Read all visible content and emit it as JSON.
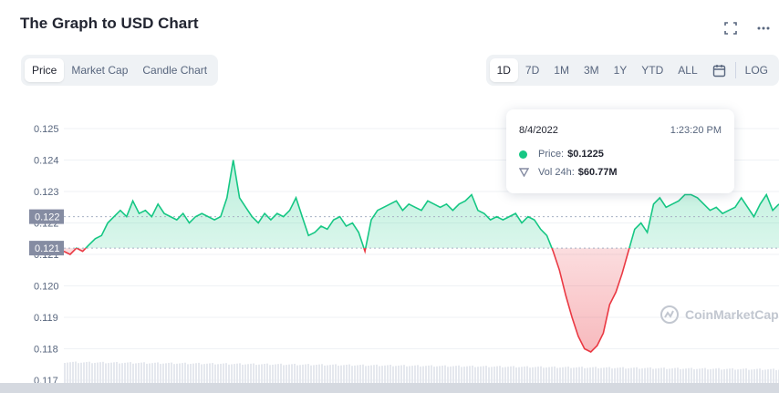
{
  "header": {
    "title": "The Graph to USD Chart"
  },
  "view_tabs": [
    {
      "label": "Price",
      "active": true
    },
    {
      "label": "Market Cap",
      "active": false
    },
    {
      "label": "Candle Chart",
      "active": false
    }
  ],
  "range_tabs": [
    {
      "label": "1D",
      "active": true
    },
    {
      "label": "7D",
      "active": false
    },
    {
      "label": "1M",
      "active": false
    },
    {
      "label": "3M",
      "active": false
    },
    {
      "label": "1Y",
      "active": false
    },
    {
      "label": "YTD",
      "active": false
    },
    {
      "label": "ALL",
      "active": false
    }
  ],
  "log_label": "LOG",
  "icons": [
    "fullscreen-icon",
    "more-icon",
    "calendar-icon",
    "coinmarketcap-logo-icon",
    "volume-icon"
  ],
  "tooltip": {
    "date": "8/4/2022",
    "time": "1:23:20 PM",
    "price_label": "Price:",
    "price_value": "$0.1225",
    "vol_label": "Vol 24h:",
    "vol_value": "$60.77M"
  },
  "watermark": "CoinMarketCap",
  "colors": {
    "up": "#16c784",
    "down": "#ea3943",
    "badge": "#858ca2",
    "text": "#222531",
    "muted": "#58667e"
  },
  "chart_data": {
    "type": "line",
    "y_ticks": [
      "0.125",
      "0.124",
      "0.123",
      "0.122",
      "0.121",
      "0.120",
      "0.119",
      "0.118",
      "0.117"
    ],
    "ylim": [
      0.117,
      0.1255
    ],
    "baseline": 0.1212,
    "reference_line": 0.1222,
    "badges": [
      "0.122",
      "0.121"
    ],
    "grid": true,
    "series": [
      {
        "values": [
          0.1211,
          0.121,
          0.1212,
          0.1211,
          0.1213,
          0.1215,
          0.1216,
          0.122,
          0.1222,
          0.1224,
          0.1222,
          0.1227,
          0.1223,
          0.1224,
          0.1222,
          0.1226,
          0.1223,
          0.1222,
          0.1221,
          0.1223,
          0.122,
          0.1222,
          0.1223,
          0.1222,
          0.1221,
          0.1222,
          0.1228,
          0.124,
          0.1228,
          0.1225,
          0.1222,
          0.122,
          0.1223,
          0.1221,
          0.1223,
          0.1222,
          0.1224,
          0.1228,
          0.1222,
          0.1216,
          0.1217,
          0.1219,
          0.1218,
          0.1221,
          0.1222,
          0.1219,
          0.122,
          0.1217,
          0.1211,
          0.1221,
          0.1224,
          0.1225,
          0.1226,
          0.1227,
          0.1224,
          0.1226,
          0.1225,
          0.1224,
          0.1227,
          0.1226,
          0.1225,
          0.1226,
          0.1224,
          0.1226,
          0.1227,
          0.1229,
          0.1224,
          0.1223,
          0.1221,
          0.1222,
          0.1221,
          0.1222,
          0.1223,
          0.122,
          0.1222,
          0.1221,
          0.1218,
          0.1216,
          0.1211,
          0.1205,
          0.1197,
          0.119,
          0.1184,
          0.118,
          0.1179,
          0.1181,
          0.1185,
          0.1194,
          0.1198,
          0.1204,
          0.1211,
          0.1218,
          0.122,
          0.1217,
          0.1226,
          0.1228,
          0.1225,
          0.1226,
          0.1227,
          0.1229,
          0.1229,
          0.1228,
          0.1226,
          0.1224,
          0.1225,
          0.1223,
          0.1224,
          0.1225,
          0.1228,
          0.1225,
          0.1222,
          0.1226,
          0.1229,
          0.1224,
          0.1226
        ]
      }
    ]
  }
}
